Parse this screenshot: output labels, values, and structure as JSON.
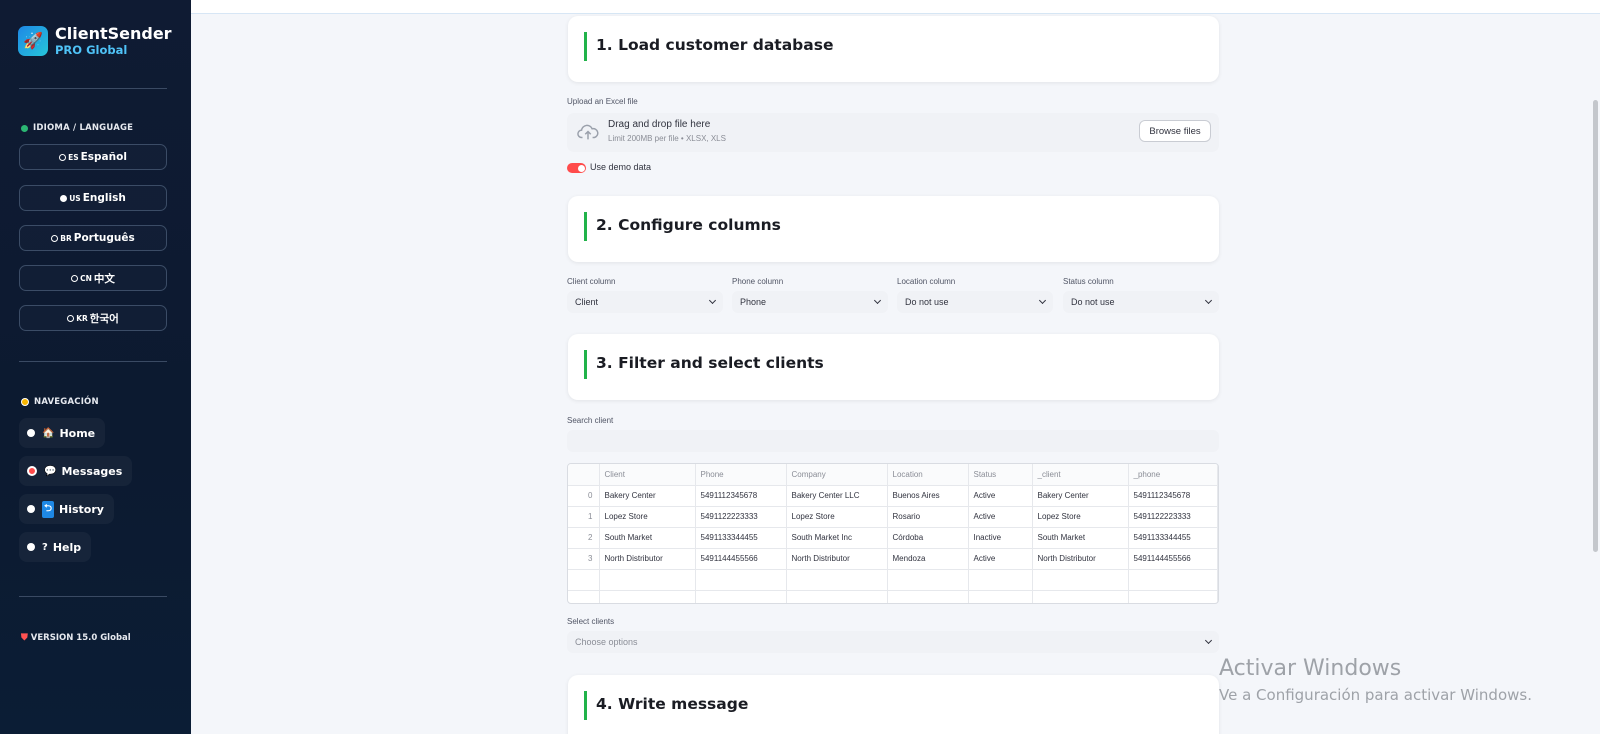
{
  "brand": {
    "name": "ClientSender",
    "subtitle": "PRO Global",
    "logo_icon": "rocket-icon"
  },
  "sidebar": {
    "language_heading": "IDIOMA / LANGUAGE",
    "languages": [
      {
        "flag": "ES",
        "label": "Español"
      },
      {
        "flag": "US",
        "label": "English"
      },
      {
        "flag": "BR",
        "label": "Português"
      },
      {
        "flag": "CN",
        "label": "中文"
      },
      {
        "flag": "KR",
        "label": "한국어"
      }
    ],
    "nav_heading": "NAVEGACIÓN",
    "nav": [
      {
        "icon": "home-icon",
        "glyph": "🏠",
        "label": "Home"
      },
      {
        "icon": "chat-icon",
        "glyph": "💬",
        "label": "Messages"
      },
      {
        "icon": "history-icon",
        "glyph": "⮌",
        "label": "History"
      },
      {
        "icon": "help-icon",
        "glyph": "?",
        "label": "Help"
      }
    ],
    "version": "VERSION 15.0 Global"
  },
  "sections": {
    "s1": "1. Load customer database",
    "s2": "2. Configure columns",
    "s3": "3. Filter and select clients",
    "s4": "4. Write message"
  },
  "upload": {
    "label": "Upload an Excel file",
    "drop_text": "Drag and drop file here",
    "limit_text": "Limit 200MB per file • XLSX, XLS",
    "browse_label": "Browse files"
  },
  "demo_toggle": {
    "label": "Use demo data",
    "on": true
  },
  "columns": [
    {
      "label": "Client column",
      "value": "Client"
    },
    {
      "label": "Phone column",
      "value": "Phone"
    },
    {
      "label": "Location column",
      "value": "Do not use"
    },
    {
      "label": "Status column",
      "value": "Do not use"
    }
  ],
  "search": {
    "label": "Search client",
    "value": ""
  },
  "table": {
    "headers": [
      "",
      "Client",
      "Phone",
      "Company",
      "Location",
      "Status",
      "_client",
      "_phone"
    ],
    "rows": [
      [
        "0",
        "Bakery Center",
        "5491112345678",
        "Bakery Center LLC",
        "Buenos Aires",
        "Active",
        "Bakery Center",
        "5491112345678"
      ],
      [
        "1",
        "Lopez Store",
        "5491122223333",
        "Lopez Store",
        "Rosario",
        "Active",
        "Lopez Store",
        "5491122223333"
      ],
      [
        "2",
        "South Market",
        "5491133344455",
        "South Market Inc",
        "Córdoba",
        "Inactive",
        "South Market",
        "5491133344455"
      ],
      [
        "3",
        "North Distributor",
        "5491144455566",
        "North Distributor",
        "Mendoza",
        "Active",
        "North Distributor",
        "5491144455566"
      ]
    ]
  },
  "select_clients": {
    "label": "Select clients",
    "placeholder": "Choose options"
  },
  "watermark": {
    "line1": "Activar Windows",
    "line2": "Ve a Configuración para activar Windows."
  },
  "colors": {
    "accent_green": "#21b34a",
    "accent_red": "#ff4b4b",
    "sidebar_bg": "#0f1b33"
  }
}
